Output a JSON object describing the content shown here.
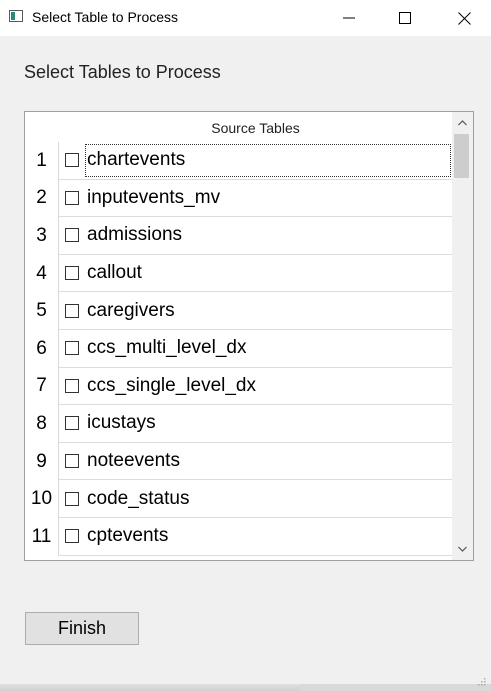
{
  "window": {
    "title": "Select Table to Process",
    "icon": "app-window-icon"
  },
  "heading": "Select Tables to Process",
  "table": {
    "column_header": "Source Tables",
    "rows": [
      {
        "num": "1",
        "label": "chartevents",
        "checked": false
      },
      {
        "num": "2",
        "label": "inputevents_mv",
        "checked": false
      },
      {
        "num": "3",
        "label": "admissions",
        "checked": false
      },
      {
        "num": "4",
        "label": "callout",
        "checked": false
      },
      {
        "num": "5",
        "label": "caregivers",
        "checked": false
      },
      {
        "num": "6",
        "label": "ccs_multi_level_dx",
        "checked": false
      },
      {
        "num": "7",
        "label": "ccs_single_level_dx",
        "checked": false
      },
      {
        "num": "8",
        "label": "icustays",
        "checked": false
      },
      {
        "num": "9",
        "label": "noteevents",
        "checked": false
      },
      {
        "num": "10",
        "label": "code_status",
        "checked": false
      },
      {
        "num": "11",
        "label": "cptevents",
        "checked": false
      }
    ]
  },
  "finish_label": "Finish"
}
